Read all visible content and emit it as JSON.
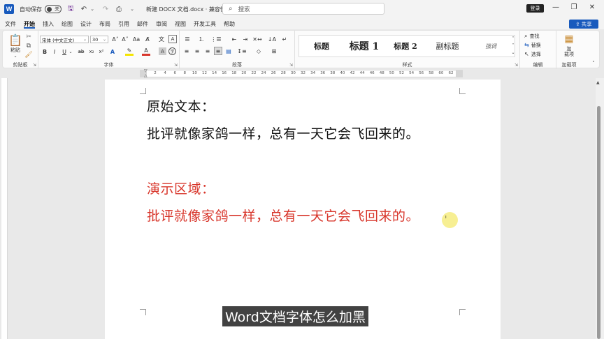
{
  "titlebar": {
    "app_icon": "word-logo",
    "app_letter": "W",
    "autosave_label": "自动保存",
    "autosave_state": "关",
    "doc_title": "新建 DOCX 文档.docx · 兼容性模式 ⌄",
    "search_placeholder": "搜索",
    "login_label": "登录"
  },
  "menu": {
    "tabs": [
      "文件",
      "开始",
      "插入",
      "绘图",
      "设计",
      "布局",
      "引用",
      "邮件",
      "审阅",
      "视图",
      "开发工具",
      "帮助"
    ],
    "active_tab": "开始",
    "share_label": "共享"
  },
  "ribbon": {
    "clipboard": {
      "label": "剪贴板",
      "paste_label": "粘贴"
    },
    "font": {
      "label": "字体",
      "font_name": "宋体 (中文正文)",
      "font_size": "30",
      "buttons": [
        "B",
        "I",
        "U",
        "ab",
        "x₂",
        "x²"
      ]
    },
    "paragraph": {
      "label": "段落"
    },
    "styles": {
      "label": "样式",
      "items": [
        "标题",
        "标题 1",
        "标题 2",
        "副标题",
        "强调"
      ]
    },
    "editing": {
      "label": "编辑",
      "find_label": "查找",
      "replace_label": "替换",
      "select_label": "选择"
    },
    "addins": {
      "label": "加载项",
      "addin_label": "加\n载项"
    }
  },
  "ruler": {
    "ticks": [
      "2",
      "4",
      "6",
      "8",
      "10",
      "12",
      "14",
      "16",
      "18",
      "20",
      "22",
      "24",
      "26",
      "28",
      "30",
      "32",
      "34",
      "36",
      "38",
      "40",
      "42",
      "44",
      "46",
      "48",
      "50",
      "52",
      "54",
      "56",
      "58",
      "60",
      "62"
    ]
  },
  "document": {
    "line1": "原始文本：",
    "line2": "批评就像家鸽一样，总有一天它会飞回来的。",
    "line3": "演示区域：",
    "line4": "批评就像家鸽一样，总有一天它会飞回来的。"
  },
  "overlay": {
    "subtitle": "Word文档字体怎么加黑"
  },
  "colors": {
    "accent": "#185abd",
    "demo_text": "#d8362b",
    "body_text": "#111111"
  }
}
